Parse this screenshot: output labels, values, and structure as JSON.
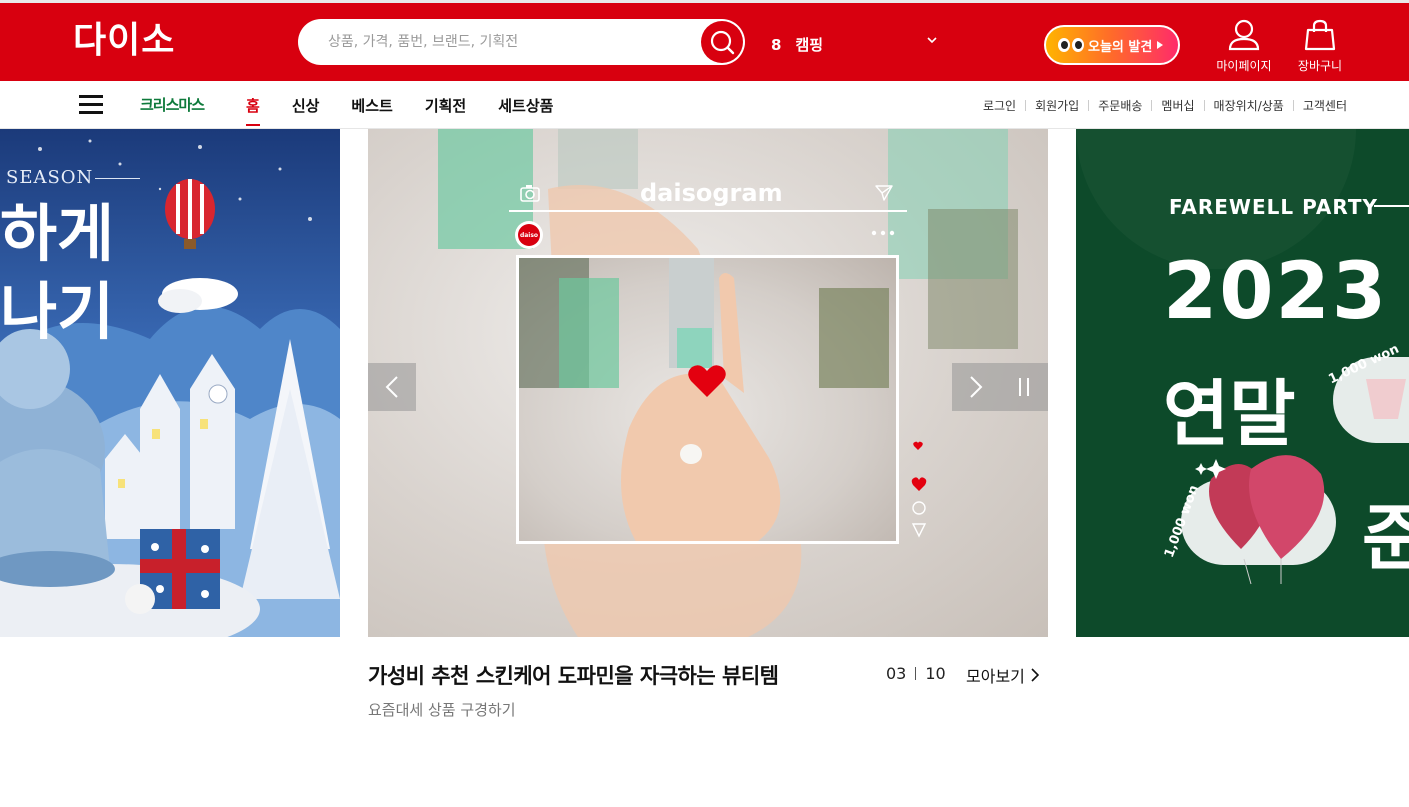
{
  "header": {
    "logo": "다이소",
    "search_placeholder": "상품, 가격, 품번, 브랜드, 기획전",
    "rank_number": "8",
    "rank_keyword": "캠핑",
    "today_button": "오늘의 발견",
    "mypage_label": "마이페이지",
    "cart_label": "장바구니",
    "brand_color": "#d8000f"
  },
  "nav": {
    "christmas_label": "크리스마스",
    "items": [
      "홈",
      "신상",
      "베스트",
      "기획전",
      "세트상품"
    ],
    "active_index": 0,
    "util_links": [
      "로그인",
      "회원가입",
      "주문배송",
      "멤버십",
      "매장위치/상품",
      "고객센터"
    ]
  },
  "banners": {
    "left": {
      "season": "SEASON",
      "line1": "하게",
      "line2": "나기"
    },
    "main": {
      "insta_title": "daisogram",
      "avatar_text": "daiso"
    },
    "right": {
      "title": "FAREWELL PARTY",
      "year": "2023",
      "word": "연말",
      "word2": "준",
      "won_label_1": "1,000 won",
      "won_label_2": "1,000 won"
    }
  },
  "caption": {
    "title": "가성비 추천 스킨케어 도파민을 자극하는 뷰티템",
    "subtitle": "요즘대세 상품 구경하기",
    "current": "03",
    "total": "10",
    "more_label": "모아보기"
  }
}
